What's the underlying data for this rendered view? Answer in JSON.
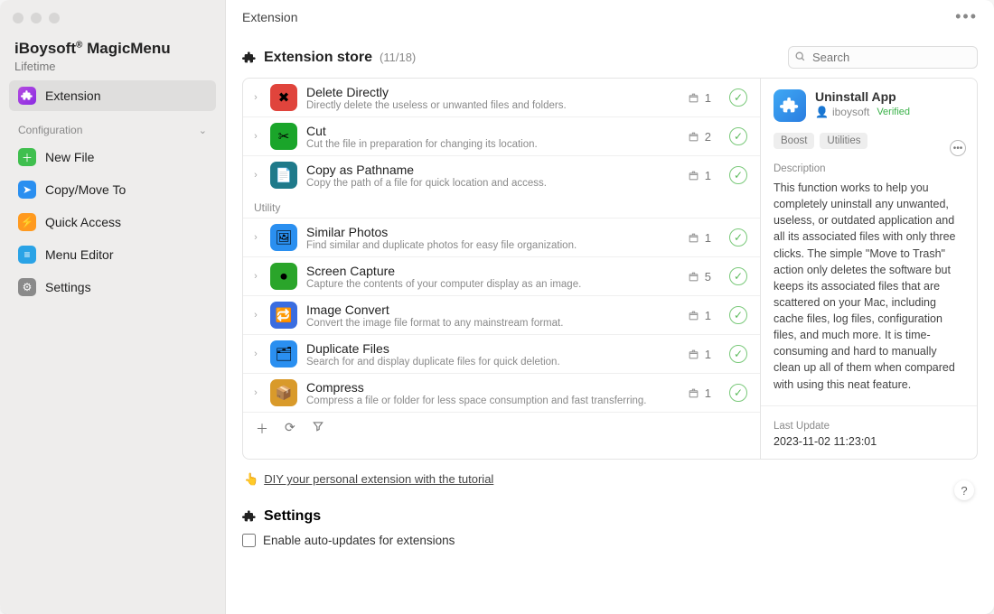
{
  "sidebar": {
    "brand_pre": "iBoysoft",
    "brand_sup": "®",
    "brand_post": " MagicMenu",
    "subtitle": "Lifetime",
    "primary": {
      "label": "Extension"
    },
    "section": "Configuration",
    "items": [
      {
        "label": "New File",
        "color": "#3fbf4e",
        "glyph": "＋"
      },
      {
        "label": "Copy/Move To",
        "color": "#2a8ff0",
        "glyph": "➤"
      },
      {
        "label": "Quick Access",
        "color": "#ff9a1f",
        "glyph": "⚡"
      },
      {
        "label": "Menu Editor",
        "color": "#2aa3e6",
        "glyph": "≡"
      },
      {
        "label": "Settings",
        "color": "#8a8a8a",
        "glyph": "⚙"
      }
    ]
  },
  "header": {
    "title": "Extension"
  },
  "store": {
    "title": "Extension store",
    "count": "(11/18)",
    "search_placeholder": "Search",
    "list_a": [
      {
        "name": "Delete Directly",
        "desc": "Directly delete the useless or unwanted files and folders.",
        "count": "1",
        "icon_bg": "#e0443c",
        "glyph": "✖"
      },
      {
        "name": "Cut",
        "desc": "Cut the file in preparation for changing its location.",
        "count": "2",
        "icon_bg": "#1aa52a",
        "glyph": "✂"
      },
      {
        "name": "Copy as Pathname",
        "desc": "Copy the path of a file for quick location and access.",
        "count": "1",
        "icon_bg": "#1f7a8a",
        "glyph": "📄"
      }
    ],
    "cat_utility": "Utility",
    "list_b": [
      {
        "name": "Similar Photos",
        "desc": "Find similar and duplicate photos for easy file organization.",
        "count": "1",
        "icon_bg": "#2a8ff0",
        "glyph": "🖼"
      },
      {
        "name": "Screen Capture",
        "desc": "Capture the contents of your computer display as an image.",
        "count": "5",
        "icon_bg": "#2aa52a",
        "glyph": "⏺"
      },
      {
        "name": "Image Convert",
        "desc": "Convert the image file format to any mainstream format.",
        "count": "1",
        "icon_bg": "#3a6de0",
        "glyph": "🔁"
      },
      {
        "name": "Duplicate Files",
        "desc": "Search for and display duplicate files for quick deletion.",
        "count": "1",
        "icon_bg": "#2a8ff0",
        "glyph": "🗂"
      },
      {
        "name": "Compress",
        "desc": "Compress a file or folder for less space consumption and fast transferring.",
        "count": "1",
        "icon_bg": "#d99a2a",
        "glyph": "📦"
      }
    ]
  },
  "detail": {
    "title": "Uninstall App",
    "author": "iboysoft",
    "verified": "Verified",
    "tags": [
      "Boost",
      "Utilities"
    ],
    "desc_label": "Description",
    "body": "This function works to help you completely uninstall any unwanted, useless, or outdated application and all its associated files with only three clicks. The simple \"Move to Trash\" action only deletes the software but keeps its associated files that are scattered on your Mac, including cache files, log files, configuration files, and much more. It is time-consuming and hard to manually clean up all of them when compared with using this neat feature.",
    "update_label": "Last Update",
    "update_value": "2023-11-02 11:23:01"
  },
  "diy": {
    "icon": "👆",
    "text": "DIY your personal extension with the tutorial"
  },
  "settings": {
    "title": "Settings",
    "auto_update": "Enable auto-updates for extensions"
  }
}
